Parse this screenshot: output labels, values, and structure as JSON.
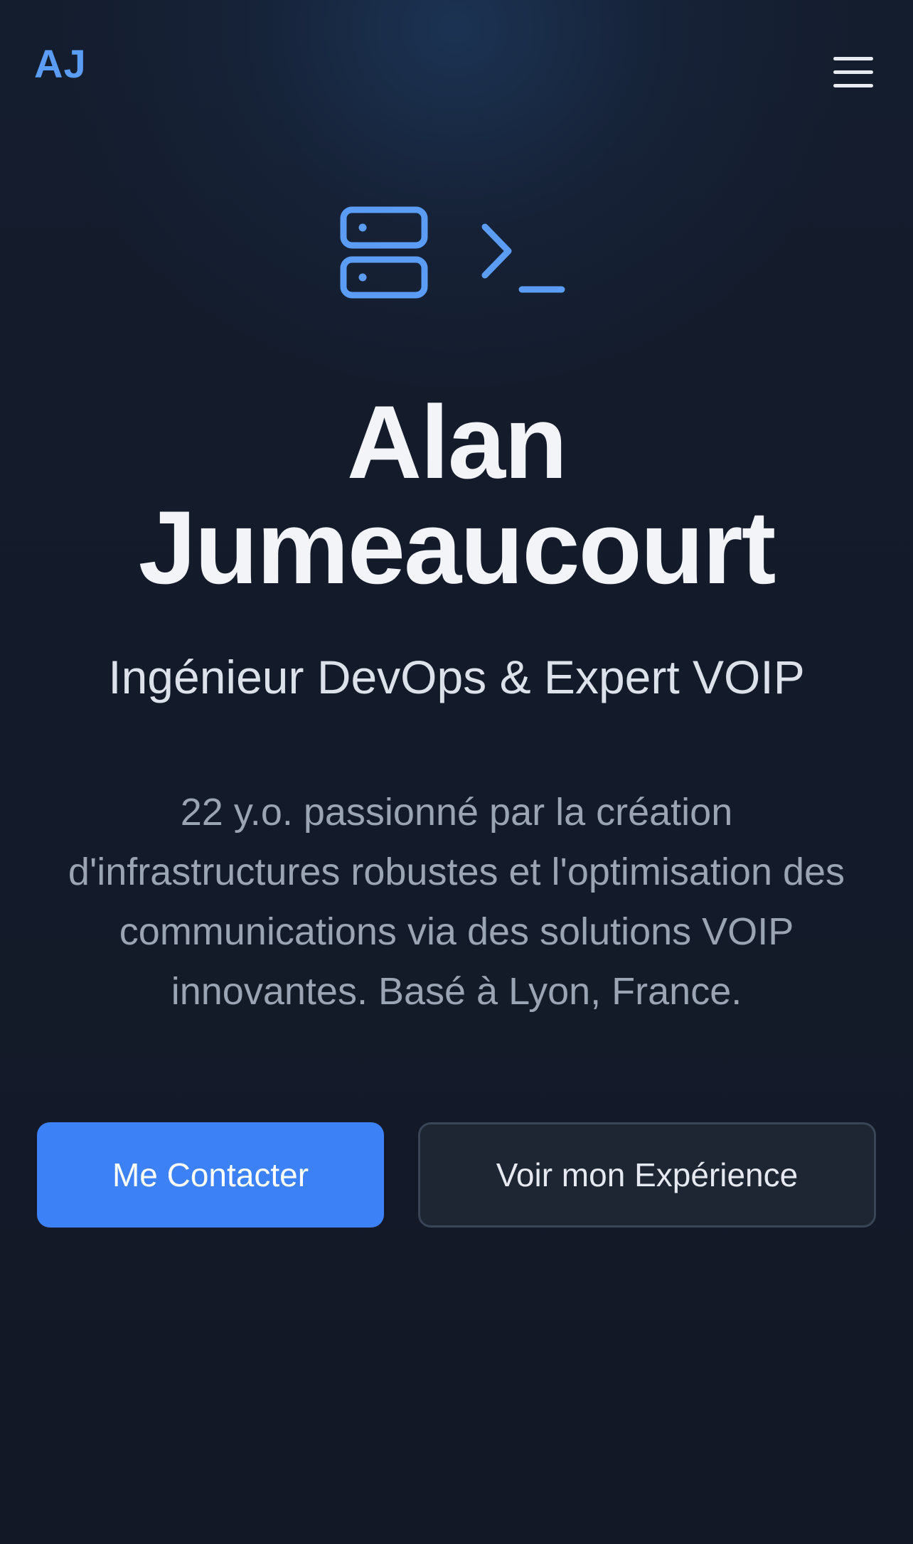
{
  "header": {
    "logo_text": "AJ",
    "menu_icon": "hamburger-menu-icon"
  },
  "hero": {
    "icons": [
      "server-icon",
      "terminal-icon"
    ],
    "name_line1": "Alan",
    "name_line2": "Jumeaucourt",
    "role": "Ingénieur DevOps & Expert VOIP",
    "bio": "22 y.o. passionné par la création d'infrastructures robustes et l'optimisation des communications via des solutions VOIP innovantes. Basé à Lyon, France."
  },
  "actions": {
    "primary_label": "Me Contacter",
    "secondary_label": "Voir mon Expérience"
  },
  "colors": {
    "accent": "#3c82f6",
    "logo": "#5b9cf5",
    "background": "#131a28"
  }
}
